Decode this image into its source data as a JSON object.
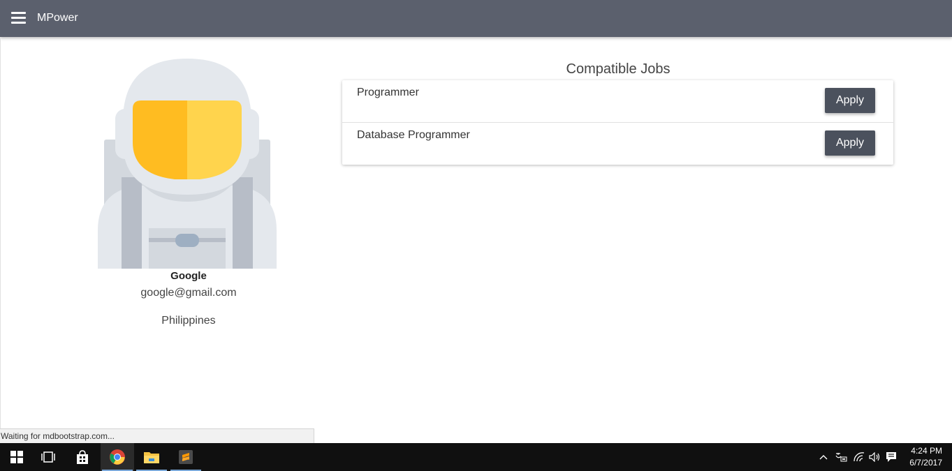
{
  "navbar": {
    "brand": "MPower",
    "menu_icon": "hamburger-menu-icon"
  },
  "profile": {
    "name": "Google",
    "email": "google@gmail.com",
    "country": "Philippines",
    "avatar_icon": "astronaut-avatar-icon"
  },
  "jobs": {
    "title": "Compatible Jobs",
    "items": [
      {
        "title": "Programmer",
        "action": "Apply"
      },
      {
        "title": "Database Programmer",
        "action": "Apply"
      }
    ]
  },
  "browser_status": {
    "text": "Waiting for mdbootstrap.com..."
  },
  "taskbar": {
    "apps": [
      "windows-start-icon",
      "task-view-icon",
      "store-icon",
      "chrome-icon",
      "file-explorer-icon",
      "sublime-text-icon"
    ],
    "tray": [
      "chevron-up-icon",
      "language-icon",
      "wifi-icon",
      "volume-icon",
      "action-center-icon"
    ],
    "time": "4:24 PM",
    "date": "6/7/2017"
  },
  "colors": {
    "navbar": "#5b606d",
    "button": "#4b515d",
    "visor_left": "#ffbc21",
    "visor_right": "#ffd44d",
    "helmet": "#e4e8ed"
  }
}
